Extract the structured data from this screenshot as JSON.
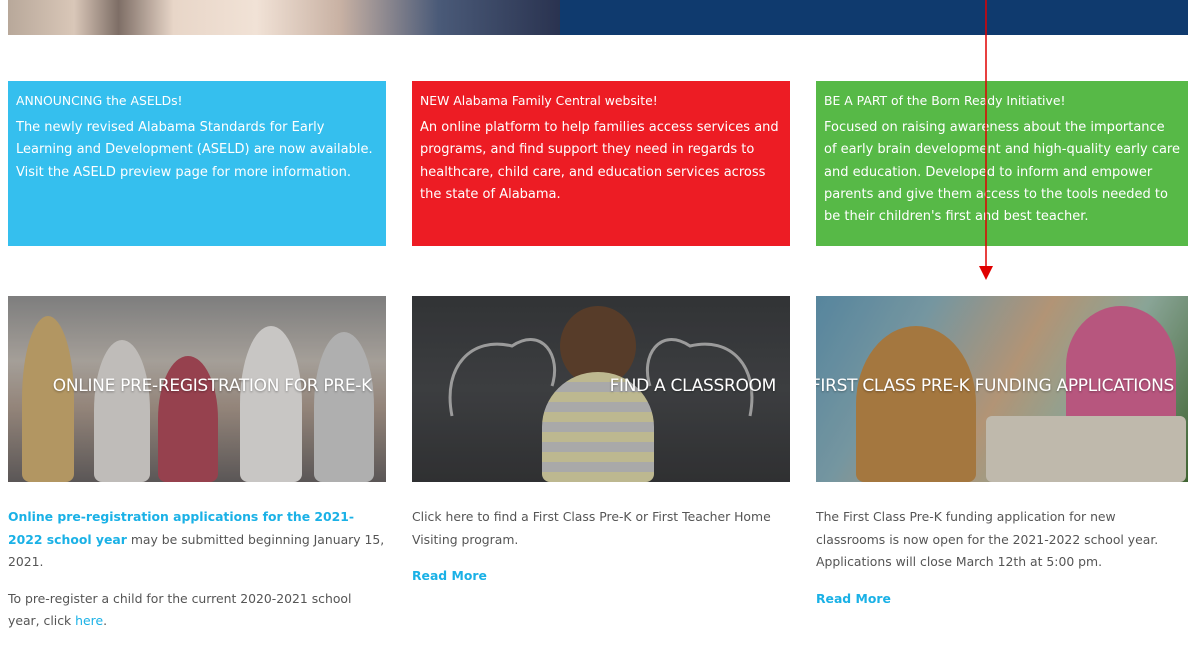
{
  "hero": {
    "photo_alt": "",
    "band_color": "#0f3a6e"
  },
  "notices": [
    {
      "title": "ANNOUNCING the ASELDs!",
      "body": "The newly revised Alabama Standards for Early Learning and Development (ASELD) are now available.  Visit the ASELD preview page for more information.",
      "color": "#35bfee"
    },
    {
      "title": "NEW Alabama Family Central website!",
      "body": "An online platform to help families access services and programs, and find support they need in regards to healthcare, child care, and education services across the state of Alabama.",
      "color": "#ed1c24"
    },
    {
      "title": "BE A PART of the Born Ready Initiative!",
      "body": "Focused on raising awareness about the importance of early brain development and high-quality early care and education.  Developed to inform and empower parents and give them access to the tools needed to be their children's first and best teacher.",
      "color": "#57b947"
    }
  ],
  "cards": [
    {
      "caption": "ONLINE PRE-REGISTRATION FOR PRE-K"
    },
    {
      "caption": "FIND A CLASSROOM"
    },
    {
      "caption": "FIRST CLASS PRE-K FUNDING APPLICATIONS"
    }
  ],
  "columns": {
    "col1": {
      "p1_link": "Online pre-registration applications for the 2021-2022 school year",
      "p1_rest": " may be submitted beginning January 15, 2021.",
      "p2_text": "To pre-register a child for the current 2020-2021 school year, click ",
      "p2_link": "here",
      "p2_end": "."
    },
    "col2": {
      "p1": "Click here to find a First Class Pre-K or First Teacher Home Visiting program.",
      "read_more": "Read More"
    },
    "col3": {
      "p1": "The First Class Pre-K funding application for new classrooms is now open for the 2021-2022 school year.  Applications will close March 12th at 5:00 pm.",
      "read_more": "Read More"
    }
  },
  "colors": {
    "link": "#1ab1e6",
    "annotation": "#e00000"
  }
}
